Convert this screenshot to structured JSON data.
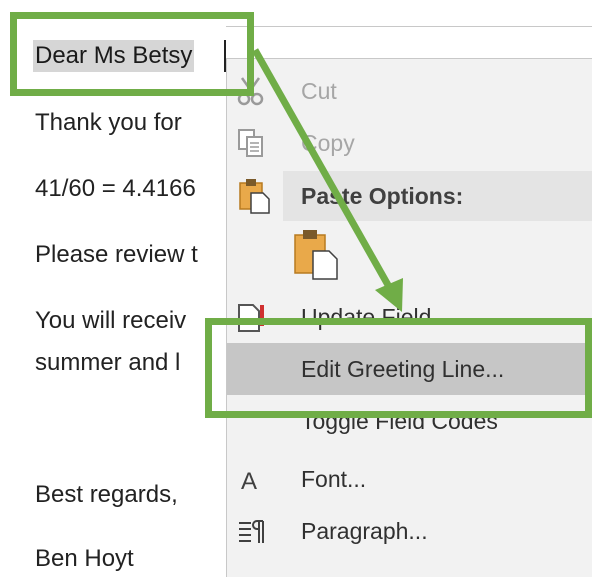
{
  "document": {
    "greeting": "Dear Ms Betsy",
    "lines": [
      "Thank you for",
      "41/60 = 4.4166",
      "Please review t",
      "You will receiv",
      "summer and l",
      "Best regards,",
      "Ben Hoyt"
    ]
  },
  "context_menu": {
    "items": {
      "cut": {
        "label": "Cut",
        "icon": "scissors-icon",
        "enabled": false
      },
      "copy": {
        "label": "Copy",
        "icon": "copy-icon",
        "enabled": false
      },
      "paste_options": {
        "label": "Paste Options:",
        "icon": "paste-icon"
      },
      "paste_keep": {
        "icon": "paste-keep-text-only-icon"
      },
      "update_field": {
        "label": "Update Field",
        "icon": "update-field-icon"
      },
      "edit_greeting": {
        "label": "Edit Greeting Line...",
        "highlighted": true
      },
      "toggle_codes": {
        "label": "Toggle Field Codes"
      },
      "font": {
        "label": "Font...",
        "icon": "font-icon"
      },
      "paragraph": {
        "label": "Paragraph...",
        "icon": "paragraph-icon"
      }
    }
  },
  "annotation": {
    "color": "#70ad47"
  }
}
